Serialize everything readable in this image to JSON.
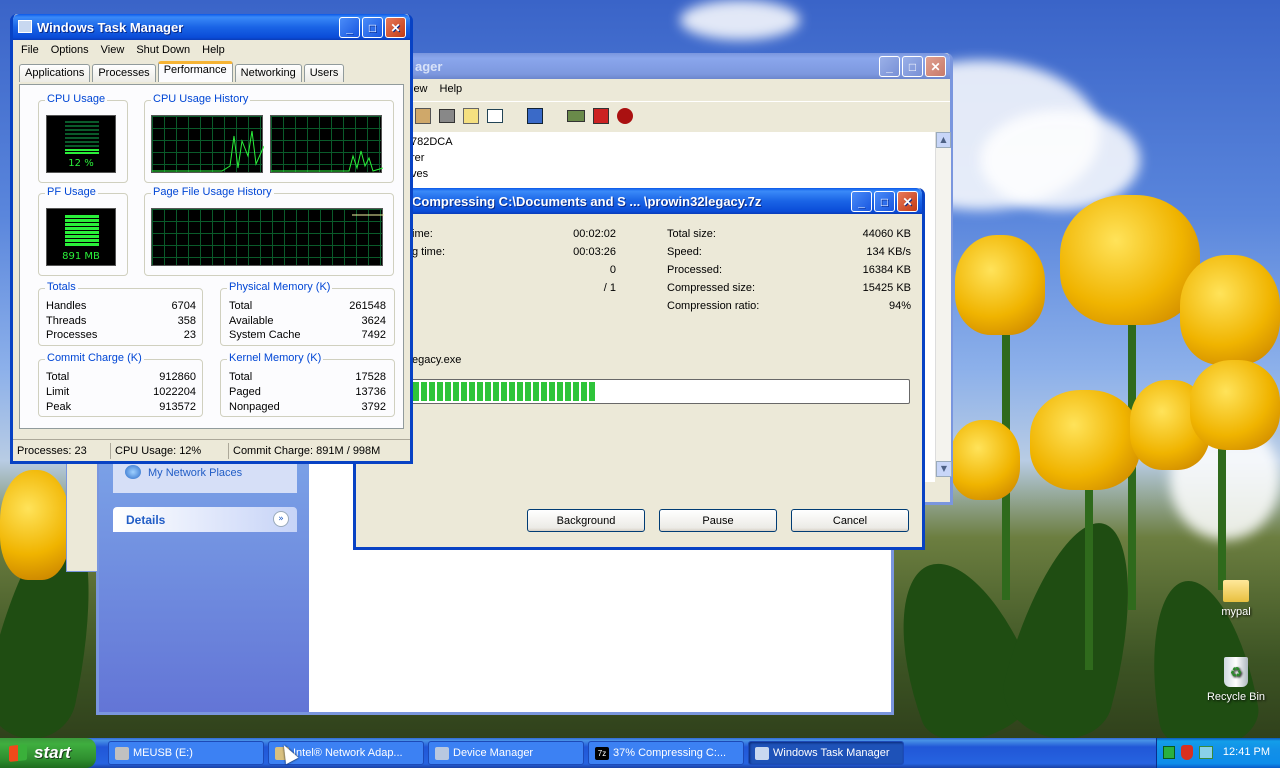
{
  "desktop": {
    "icons": [
      {
        "label": "mypal"
      },
      {
        "label": "Recycle Bin"
      }
    ]
  },
  "task_manager": {
    "title": "Windows Task Manager",
    "menu": [
      "File",
      "Options",
      "View",
      "Shut Down",
      "Help"
    ],
    "tabs": [
      "Applications",
      "Processes",
      "Performance",
      "Networking",
      "Users"
    ],
    "active_tab": "Performance",
    "cpu_usage_label": "CPU Usage",
    "cpu_usage_value": "12 %",
    "cpu_history_label": "CPU Usage History",
    "pf_usage_label": "PF Usage",
    "pf_usage_value": "891 MB",
    "pf_history_label": "Page File Usage History",
    "totals": {
      "label": "Totals",
      "rows": [
        [
          "Handles",
          "6704"
        ],
        [
          "Threads",
          "358"
        ],
        [
          "Processes",
          "23"
        ]
      ]
    },
    "physical": {
      "label": "Physical Memory (K)",
      "rows": [
        [
          "Total",
          "261548"
        ],
        [
          "Available",
          "3624"
        ],
        [
          "System Cache",
          "7492"
        ]
      ]
    },
    "commit": {
      "label": "Commit Charge (K)",
      "rows": [
        [
          "Total",
          "912860"
        ],
        [
          "Limit",
          "1022204"
        ],
        [
          "Peak",
          "913572"
        ]
      ]
    },
    "kernel": {
      "label": "Kernel Memory (K)",
      "rows": [
        [
          "Total",
          "17528"
        ],
        [
          "Paged",
          "13736"
        ],
        [
          "Nonpaged",
          "3792"
        ]
      ]
    },
    "status": [
      "Processes: 23",
      "CPU Usage: 12%",
      "Commit Charge: 891M / 998M"
    ]
  },
  "device_manager": {
    "title_partial": "ager",
    "menu": [
      "iew",
      "Help"
    ],
    "tree": [
      "782DCA",
      "rer",
      "ves"
    ]
  },
  "explorer": {
    "network_places": "My Network Places",
    "details": "Details"
  },
  "compress": {
    "title": "Compressing C:\\Documents and S ... \\prowin32legacy.7z",
    "left": [
      [
        "ime:",
        "00:02:02"
      ],
      [
        "g time:",
        "00:03:26"
      ],
      [
        "",
        "0"
      ],
      [
        "",
        "/ 1"
      ]
    ],
    "right": [
      [
        "Total size:",
        "44060 KB"
      ],
      [
        "Speed:",
        "134 KB/s"
      ],
      [
        "Processed:",
        "16384 KB"
      ],
      [
        "Compressed size:",
        "15425 KB"
      ],
      [
        "Compression ratio:",
        "94%"
      ]
    ],
    "file": "egacy.exe",
    "progress": 0.37,
    "buttons": [
      "Background",
      "Pause",
      "Cancel"
    ]
  },
  "taskbar": {
    "start": "start",
    "tasks": [
      "MEUSB (E:)",
      "Intel® Network Adap...",
      "Device Manager",
      "37% Compressing C:...",
      "Windows Task Manager"
    ],
    "clock": "12:41 PM"
  }
}
